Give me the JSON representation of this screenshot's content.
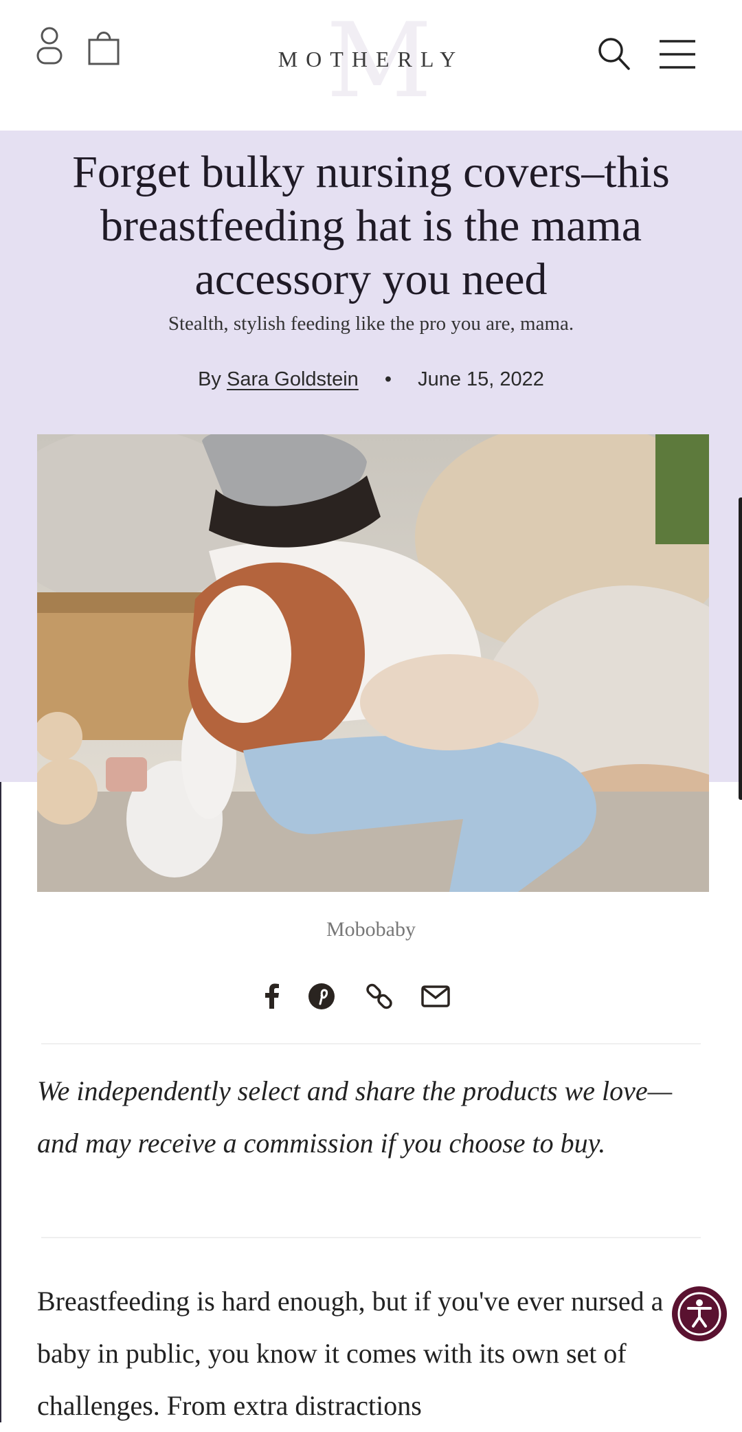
{
  "brand": {
    "logo_text": "MOTHERLY",
    "monogram": "M",
    "accent": "#5a1230",
    "hero_bg": "#e5e0f2"
  },
  "header": {
    "account_icon": "user-icon",
    "cart_icon": "shopping-bag-icon",
    "search_icon": "search-icon",
    "menu_icon": "hamburger-menu-icon"
  },
  "article": {
    "title": "Forget bulky nursing covers–this breastfeeding hat is the mama accessory you need",
    "dek": "Stealth, stylish feeding like the pro you are, mama.",
    "byline_prefix": "By",
    "author": "Sara Goldstein",
    "separator": "•",
    "date": "June 15, 2022",
    "image_caption": "Mobobaby",
    "disclaimer": "We independently select and share the products we love—and may receive a commission if you choose to buy.",
    "body_paragraph": "Breastfeeding is hard enough, but if you've ever nursed a baby in public, you know it comes with its own set of challenges. From extra distractions"
  },
  "share": [
    {
      "icon": "facebook-icon"
    },
    {
      "icon": "pinterest-icon"
    },
    {
      "icon": "link-icon"
    },
    {
      "icon": "email-icon"
    }
  ],
  "accessibility": {
    "icon": "accessibility-icon"
  }
}
